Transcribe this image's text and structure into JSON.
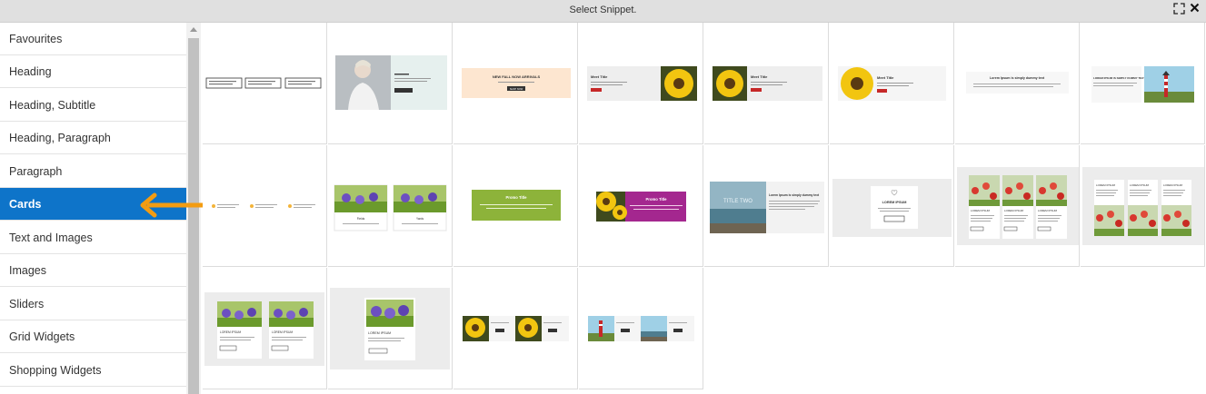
{
  "window": {
    "title": "Select Snippet."
  },
  "icons": {
    "expand": "expand-icon",
    "close": "close-icon"
  },
  "sidebar": {
    "items": [
      {
        "label": "Favourites"
      },
      {
        "label": "Heading"
      },
      {
        "label": "Heading, Subtitle"
      },
      {
        "label": "Heading, Paragraph"
      },
      {
        "label": "Paragraph"
      },
      {
        "label": "Cards",
        "active": true
      },
      {
        "label": "Text and Images"
      },
      {
        "label": "Images"
      },
      {
        "label": "Sliders"
      },
      {
        "label": "Grid Widgets"
      },
      {
        "label": "Shopping Widgets"
      }
    ]
  },
  "snippets": {
    "tile3": {
      "heading": "NEW FALL NOW ARRIVALS",
      "button": "SHOP NOW"
    },
    "tile4": {
      "heading": "Meet Title"
    },
    "tile5": {
      "heading": "Meet Title"
    },
    "tile6": {
      "heading": "Meet Title"
    },
    "tile7": {
      "heading": "Lorem Ipsum is simply dummy text"
    },
    "tile8": {
      "heading": "LOREM IPSUM IS SIMPLY DUMMY TEXT"
    },
    "tile10": {
      "caption_a": "Fields",
      "caption_b": "Yards"
    },
    "tile11": {
      "heading": "Promo Title"
    },
    "tile12": {
      "heading": "Promo Title"
    },
    "tile13": {
      "overlay": "TITLE TWO",
      "heading": "Lorem Ipsum is simply dummy text"
    },
    "tile14": {
      "heading": "LOREM IPSUM"
    },
    "tile15": {
      "heading": "LOREM IPSUM"
    },
    "tile16": {
      "heading": "LOREM IPSUM"
    },
    "tile17": {
      "heading": "LOREM IPSUM"
    },
    "tile18": {
      "heading": "LOREM IPSUM"
    }
  },
  "colors": {
    "active": "#0e74c9",
    "arrow": "#f39c12",
    "promo_green": "#8db33a",
    "promo_purple": "#a4278f",
    "peach": "#fde6d0",
    "mint": "#e6f0ee"
  }
}
